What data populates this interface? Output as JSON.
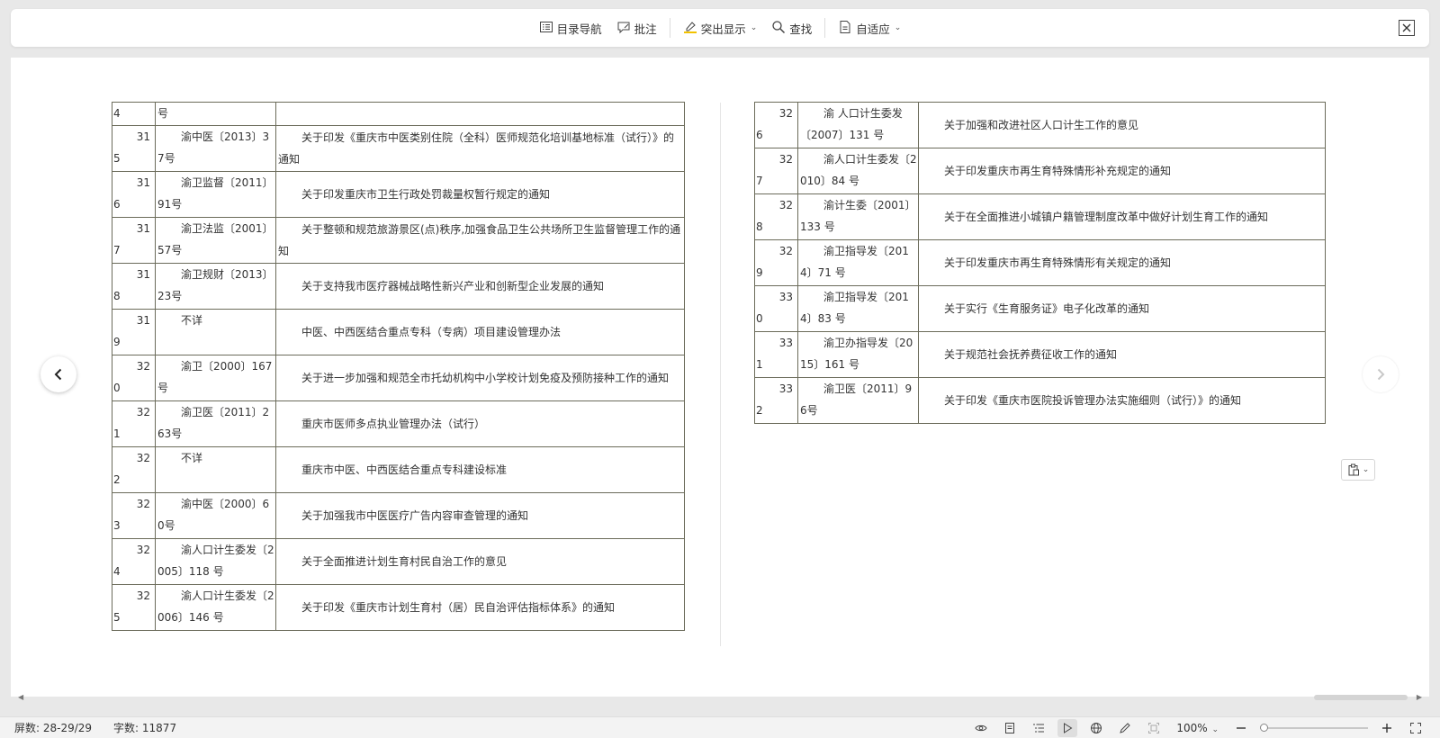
{
  "toolbar": {
    "toc_label": "目录导航",
    "comment_label": "批注",
    "highlight_label": "突出显示",
    "find_label": "查找",
    "fit_label": "自适应"
  },
  "left_rows": [
    {
      "num_a": "4",
      "num_b": "",
      "code": "号",
      "title": ""
    },
    {
      "num_a": "31",
      "num_b": "5",
      "code": "渝中医〔2013〕37号",
      "title": "关于印发《重庆市中医类别住院（全科）医师规范化培训基地标准（试行）》的通知"
    },
    {
      "num_a": "31",
      "num_b": "6",
      "code": "渝卫监督〔2011〕91号",
      "title": "关于印发重庆市卫生行政处罚裁量权暂行规定的通知"
    },
    {
      "num_a": "31",
      "num_b": "7",
      "code": "渝卫法监〔2001〕57号",
      "title": "关于整顿和规范旅游景区(点)秩序,加强食品卫生公共场所卫生监督管理工作的通知"
    },
    {
      "num_a": "31",
      "num_b": "8",
      "code": "渝卫规财〔2013〕23号",
      "title": "关于支持我市医疗器械战略性新兴产业和创新型企业发展的通知"
    },
    {
      "num_a": "31",
      "num_b": "9",
      "code": "不详",
      "title": "中医、中西医结合重点专科（专病）项目建设管理办法"
    },
    {
      "num_a": "32",
      "num_b": "0",
      "code": "渝卫〔2000〕167号",
      "title": "关于进一步加强和规范全市托幼机构中小学校计划免疫及预防接种工作的通知"
    },
    {
      "num_a": "32",
      "num_b": "1",
      "code": "渝卫医〔2011〕263号",
      "title": "重庆市医师多点执业管理办法（试行）"
    },
    {
      "num_a": "32",
      "num_b": "2",
      "code": "不详",
      "title": "重庆市中医、中西医结合重点专科建设标准"
    },
    {
      "num_a": "32",
      "num_b": "3",
      "code": "渝中医〔2000〕60号",
      "title": "关于加强我市中医医疗广告内容审查管理的通知"
    },
    {
      "num_a": "32",
      "num_b": "4",
      "code": "渝人口计生委发〔2005〕118 号",
      "title": "关于全面推进计划生育村民自治工作的意见"
    },
    {
      "num_a": "32",
      "num_b": "5",
      "code": "渝人口计生委发〔2006〕146 号",
      "title": "关于印发《重庆市计划生育村（居）民自治评估指标体系》的通知"
    }
  ],
  "right_rows": [
    {
      "num_a": "32",
      "num_b": "6",
      "code": "渝 人口计生委发〔2007〕131 号",
      "title": "关于加强和改进社区人口计生工作的意见"
    },
    {
      "num_a": "32",
      "num_b": "7",
      "code": "渝人口计生委发〔2010〕84 号",
      "title": "关于印发重庆市再生育特殊情形补充规定的通知"
    },
    {
      "num_a": "32",
      "num_b": "8",
      "code": "渝计生委〔2001〕133 号",
      "title": "关于在全面推进小城镇户籍管理制度改革中做好计划生育工作的通知"
    },
    {
      "num_a": "32",
      "num_b": "9",
      "code": "渝卫指导发〔2014〕71 号",
      "title": "关于印发重庆市再生育特殊情形有关规定的通知"
    },
    {
      "num_a": "33",
      "num_b": "0",
      "code": "渝卫指导发〔2014〕83 号",
      "title": "关于实行《生育服务证》电子化改革的通知"
    },
    {
      "num_a": "33",
      "num_b": "1",
      "code": "渝卫办指导发〔2015〕161 号",
      "title": "关于规范社会抚养费征收工作的通知"
    },
    {
      "num_a": "33",
      "num_b": "2",
      "code": "渝卫医〔2011〕96号",
      "title": "关于印发《重庆市医院投诉管理办法实施细则（试行）》的通知"
    }
  ],
  "status": {
    "screen_label": "屏数: 28-29/29",
    "word_count_label": "字数: 11877",
    "zoom_label": "100%"
  },
  "zoom_level": 0.0,
  "icons": {
    "toc": "toc-icon",
    "comment": "comment-icon",
    "highlight": "highlighter-icon",
    "find": "search-icon",
    "fit": "fit-page-icon",
    "close": "close-icon"
  },
  "colors": {
    "table_border": "#6b6b5a",
    "highlight_accent": "#f2c200"
  }
}
